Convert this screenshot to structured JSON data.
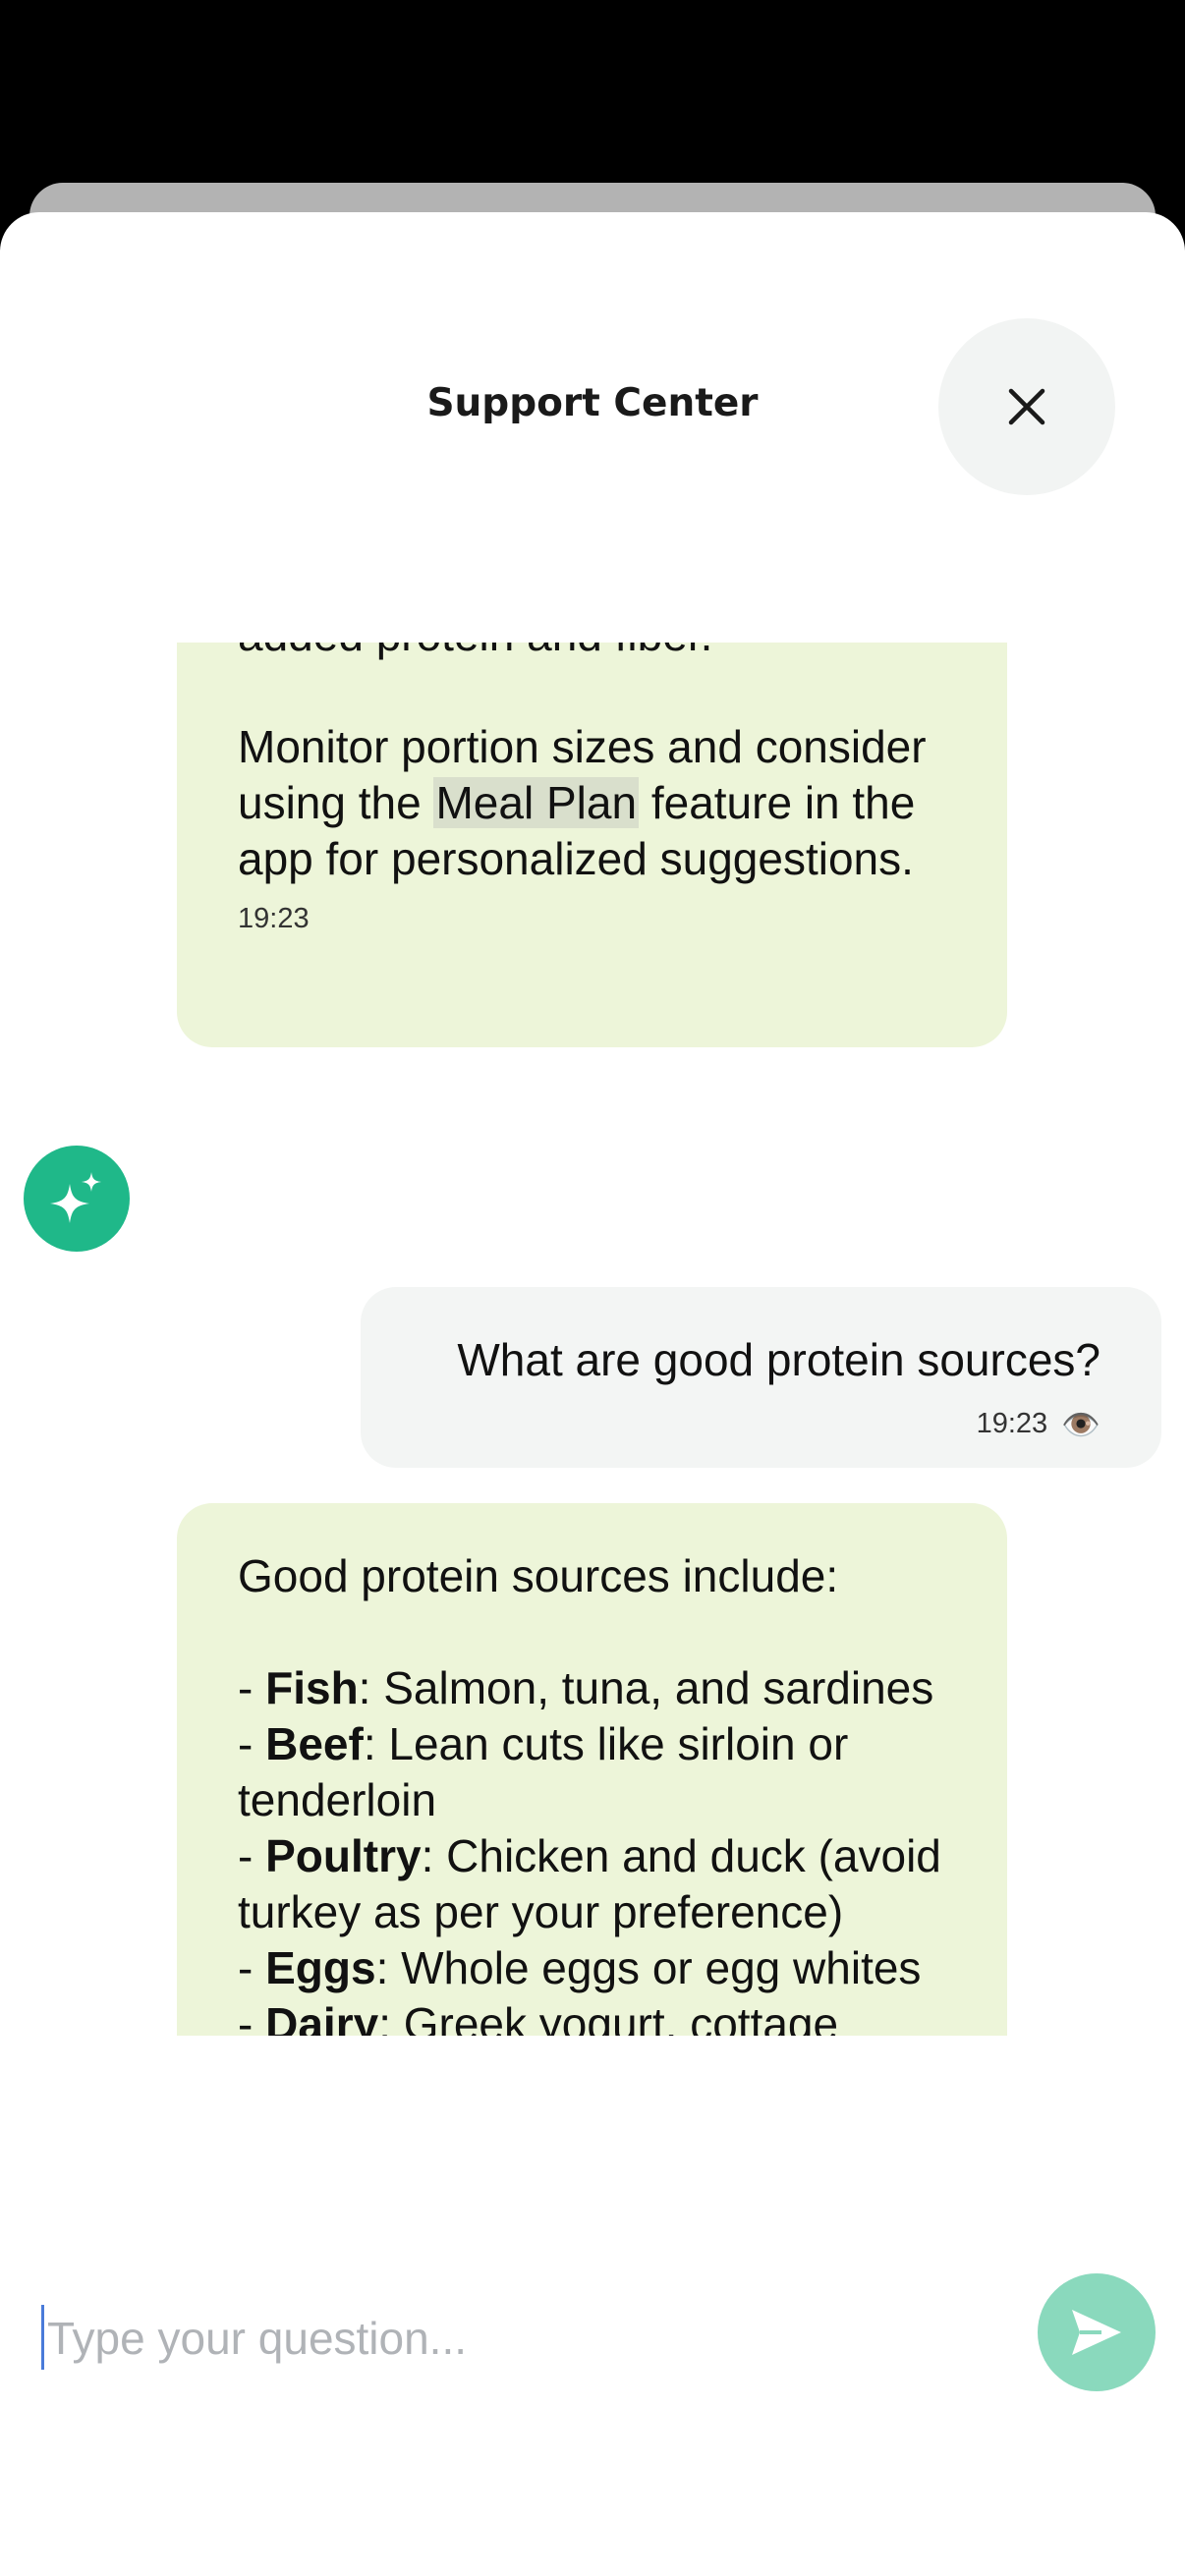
{
  "header": {
    "title": "Support Center",
    "close_icon": "close-icon"
  },
  "messages": {
    "bot_partial": {
      "line_cut": "added protein and fiber.",
      "text_before": "Monitor portion sizes and consider using the ",
      "highlight": "Meal Plan",
      "text_after": " feature in the app for personalized suggestions.",
      "time": "19:23"
    },
    "user": {
      "text": "What are good protein sources?",
      "time": "19:23",
      "status_icon": "eye-icon"
    },
    "bot_protein": {
      "intro": "Good protein sources include:",
      "items": [
        {
          "label": "Fish",
          "text": ": Salmon, tuna, and sardines"
        },
        {
          "label": "Beef",
          "text": ": Lean cuts like sirloin or tenderloin"
        },
        {
          "label": "Poultry",
          "text": ": Chicken and duck (avoid turkey as per your preference)"
        },
        {
          "label": "Eggs",
          "text": ": Whole eggs or egg whites"
        },
        {
          "label": "Dairy",
          "text": ": Greek yogurt, cottage cheese, and milk"
        }
      ]
    }
  },
  "assistant": {
    "avatar_icon": "sparkle-icon",
    "accent_color": "#1fb889"
  },
  "composer": {
    "placeholder": "Type your question...",
    "send_icon": "send-icon",
    "send_color": "#8ad9bd"
  },
  "colors": {
    "bot_bubble": "#edf5d9",
    "user_bubble": "#f3f5f4",
    "highlight": "#d9dfcc"
  }
}
